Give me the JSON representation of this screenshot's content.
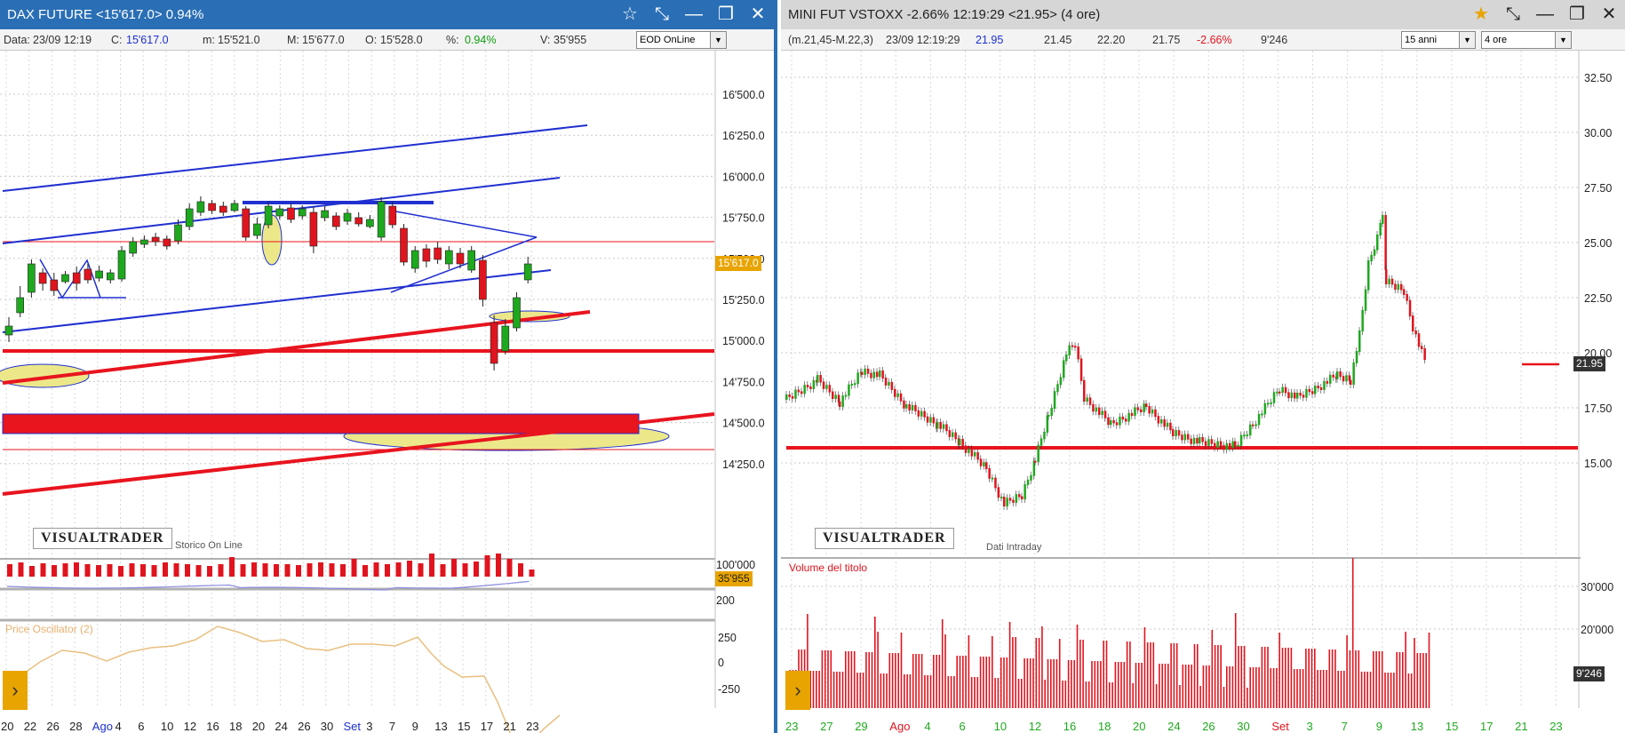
{
  "left": {
    "title": "DAX FUTURE <15'617.0> 0.94%",
    "info": {
      "data_label": "Data:",
      "data_val": "23/09 12:19",
      "c_label": "C:",
      "c_val": "15'617.0",
      "m_label": "m:",
      "m_val": "15'521.0",
      "M_label": "M:",
      "M_val": "15'677.0",
      "o_label": "O:",
      "o_val": "15'528.0",
      "pct_label": "%:",
      "pct_val": "0.94%",
      "v_label": "V:",
      "v_val": "35'955"
    },
    "dropdown": "EOD OnLine",
    "logo": "VISUALTRADER",
    "storico": "Storico On Line",
    "price_tag": "15'617.0",
    "price_ticks": [
      "16'500.0",
      "16'250.0",
      "16'000.0",
      "15'750.0",
      "15'500.0",
      "15'250.0",
      "15'000.0",
      "14'750.0",
      "14'500.0",
      "14'250.0"
    ],
    "volume_ticks": [
      "100'000",
      "200"
    ],
    "volume_tag": "35'955",
    "oscillator_label": "Price Oscillator (2)",
    "osc_ticks": [
      "250",
      "0",
      "-250"
    ],
    "date_labels": [
      "20",
      "22",
      "26",
      "28",
      "Ago",
      "4",
      "6",
      "10",
      "12",
      "16",
      "18",
      "20",
      "24",
      "26",
      "30",
      "Set",
      "3",
      "7",
      "9",
      "13",
      "15",
      "17",
      "21",
      "23"
    ]
  },
  "right": {
    "title": "MINI FUT VSTOXX -2.66% 12:19:29 <21.95> (4 ore)",
    "info": {
      "ma": "(m.21,45-M.22,3)",
      "date": "23/09 12:19:29",
      "last": "21.95",
      "open": "21.45",
      "high": "22.20",
      "low": "21.75",
      "pct": "-2.66%",
      "vol": "9'246"
    },
    "dropdown1": "15 anni",
    "dropdown2": "4 ore",
    "logo": "VISUALTRADER",
    "dati": "Dati Intraday",
    "price_tag": "21.95",
    "price_ticks": [
      "32.50",
      "30.00",
      "27.50",
      "25.00",
      "22.50",
      "20.00",
      "17.50",
      "15.00"
    ],
    "volume_label": "Volume del titolo",
    "volume_ticks": [
      "30'000",
      "20'000"
    ],
    "volume_tag": "9'246",
    "date_labels": [
      "23",
      "27",
      "29",
      "Ago",
      "4",
      "6",
      "10",
      "12",
      "16",
      "18",
      "20",
      "24",
      "26",
      "30",
      "Set",
      "3",
      "7",
      "9",
      "13",
      "15",
      "17",
      "21",
      "23"
    ]
  },
  "colors": {
    "title_blue": "#2a6fb5",
    "up_candle": "#1ea81e",
    "down_candle": "#e0141e",
    "trend_blue": "#2030d0",
    "support_red": "#e8141e",
    "ellipse_fill": "#ece88a"
  }
}
